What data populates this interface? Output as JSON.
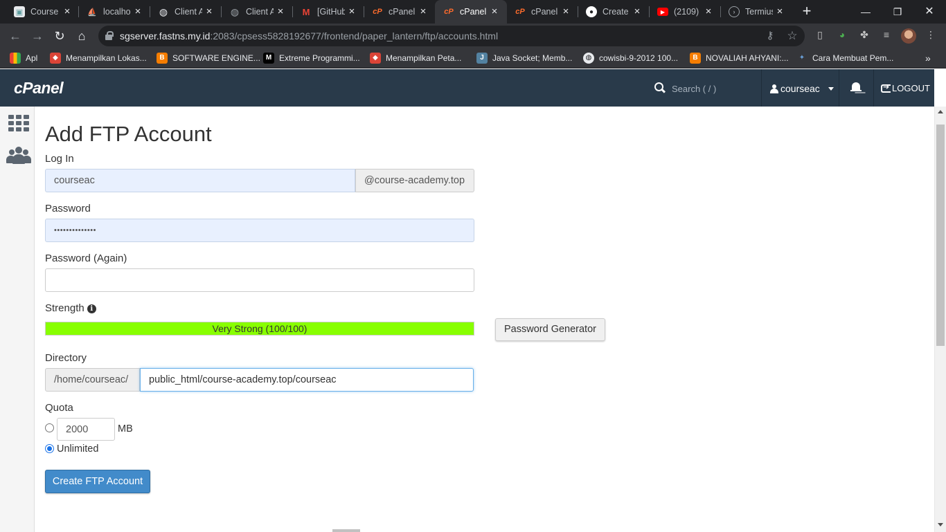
{
  "browser": {
    "tabs": [
      {
        "title": "Courses",
        "icon_name": "site-favicon-icon",
        "icon_color": "#5f9ea0",
        "active": false
      },
      {
        "title": "localhost",
        "icon_name": "phpmyadmin-icon",
        "icon_color": "#f29111",
        "active": false
      },
      {
        "title": "Client A",
        "icon_name": "globe-icon",
        "icon_color": "#9aa0a6",
        "active": false
      },
      {
        "title": "Client A",
        "icon_name": "globe-icon",
        "icon_color": "#9aa0a6",
        "active": false
      },
      {
        "title": "[GitHub",
        "icon_name": "gmail-icon",
        "icon_color": "#ea4335",
        "active": false
      },
      {
        "title": "cPanel",
        "icon_name": "cpanel-icon",
        "icon_color": "#ff6c2c",
        "active": false
      },
      {
        "title": "cPanel",
        "icon_name": "cpanel-icon",
        "icon_color": "#ff6c2c",
        "active": true
      },
      {
        "title": "cPanel",
        "icon_name": "cpanel-icon",
        "icon_color": "#ff6c2c",
        "active": false
      },
      {
        "title": "Create",
        "icon_name": "github-icon",
        "icon_color": "#ffffff",
        "active": false
      },
      {
        "title": "(2109)",
        "icon_name": "youtube-icon",
        "icon_color": "#ff0000",
        "active": false
      },
      {
        "title": "Termius",
        "icon_name": "termius-icon",
        "icon_color": "#9aa0a6",
        "active": false
      }
    ],
    "url_host": "sgserver.fastns.my.id",
    "url_rest": ":2083/cpsess5828192677/frontend/paper_lantern/ftp/accounts.html",
    "bookmarks": [
      {
        "label": "Apl",
        "icon_name": "apps-grid-icon",
        "icon_color": "#e8eaed"
      },
      {
        "label": "Menampilkan Lokas...",
        "icon_name": "maps-icon",
        "icon_color": "#db4437"
      },
      {
        "label": "SOFTWARE ENGINE...",
        "icon_name": "blogger-icon",
        "icon_color": "#f57d00"
      },
      {
        "label": "Extreme Programmi...",
        "icon_name": "medium-icon",
        "icon_color": "#000000"
      },
      {
        "label": "Menampilkan Peta...",
        "icon_name": "maps-icon",
        "icon_color": "#db4437"
      },
      {
        "label": "Java Socket; Memb...",
        "icon_name": "java-icon",
        "icon_color": "#5382a1"
      },
      {
        "label": "cowisbi-9-2012 100...",
        "icon_name": "globe-icon",
        "icon_color": "#9aa0a6"
      },
      {
        "label": "NOVALIAH AHYANI:...",
        "icon_name": "blogger-icon",
        "icon_color": "#f57d00"
      },
      {
        "label": "Cara Membuat Pem...",
        "icon_name": "site-favicon-icon",
        "icon_color": "#6aa0d8"
      }
    ]
  },
  "cpanel": {
    "logo": "cPanel",
    "search_placeholder": "Search ( / )",
    "username": "courseac",
    "logout_label": "LOGOUT",
    "header_color": "#293a4a"
  },
  "form": {
    "title": "Add FTP Account",
    "login_label": "Log In",
    "login_value": "courseac",
    "domain_suffix": "@course-academy.top",
    "password_label": "Password",
    "password_value": "••••••••••••••",
    "password_again_label": "Password (Again)",
    "password_again_value": "",
    "strength_label": "Strength",
    "strength_text": "Very Strong (100/100)",
    "strength_score": 100,
    "strength_color": "#88ff00",
    "password_generator_label": "Password Generator",
    "directory_label": "Directory",
    "directory_prefix": "/home/courseac/",
    "directory_value": "public_html/course-academy.top/courseac",
    "quota_label": "Quota",
    "quota_value": "2000",
    "quota_unit": "MB",
    "unlimited_label": "Unlimited",
    "quota_selected": "unlimited",
    "submit_label": "Create FTP Account",
    "submit_color": "#428bca"
  }
}
